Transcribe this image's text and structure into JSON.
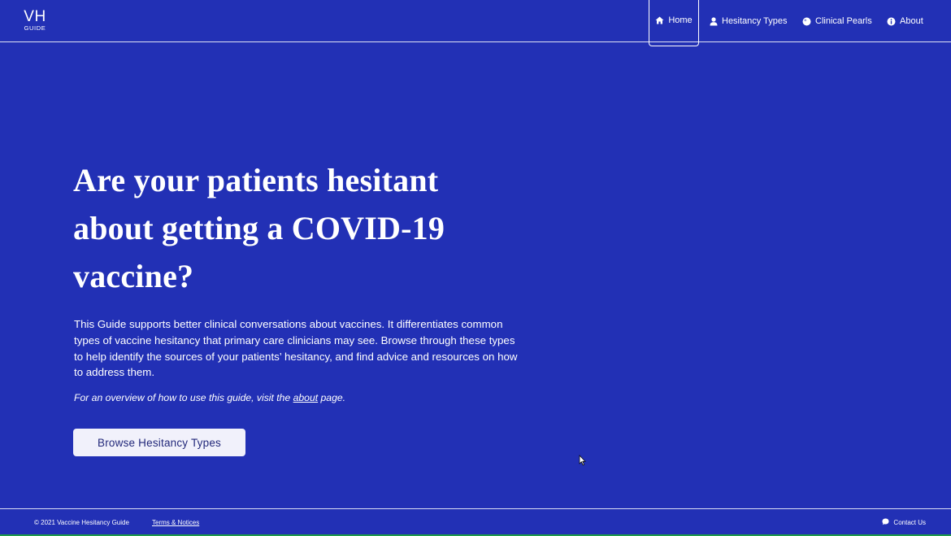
{
  "logo": {
    "main": "VH",
    "sub": "GUIDE"
  },
  "nav": {
    "items": [
      {
        "label": "Home",
        "icon": "home-icon",
        "active": true
      },
      {
        "label": "Hesitancy Types",
        "icon": "person-icon",
        "active": false
      },
      {
        "label": "Clinical Pearls",
        "icon": "pearl-icon",
        "active": false
      },
      {
        "label": "About",
        "icon": "info-icon",
        "active": false
      }
    ]
  },
  "hero": {
    "title_line1": "Are your patients hesitant",
    "title_line2": "about getting a COVID-19",
    "title_line3": "vaccine?",
    "description": "This Guide supports better clinical conversations about vaccines. It differentiates common types of vaccine hesitancy that primary care clinicians may see. Browse through these types to help identify the sources of your patients’ hesitancy, and find advice and resources on how to address them.",
    "note_prefix": "For an overview of how to use this guide, visit the ",
    "note_link": "about",
    "note_suffix": " page.",
    "button_label": "Browse Hesitancy Types"
  },
  "footer": {
    "copyright": "© 2021 Vaccine Hesitancy Guide",
    "terms": "Terms & Notices",
    "contact": "Contact Us"
  },
  "colors": {
    "background": "#2230b5",
    "text": "#ffffff",
    "button_bg": "#f1f1fb",
    "button_text": "#22287a",
    "footer_accent": "#1e9a4a"
  }
}
